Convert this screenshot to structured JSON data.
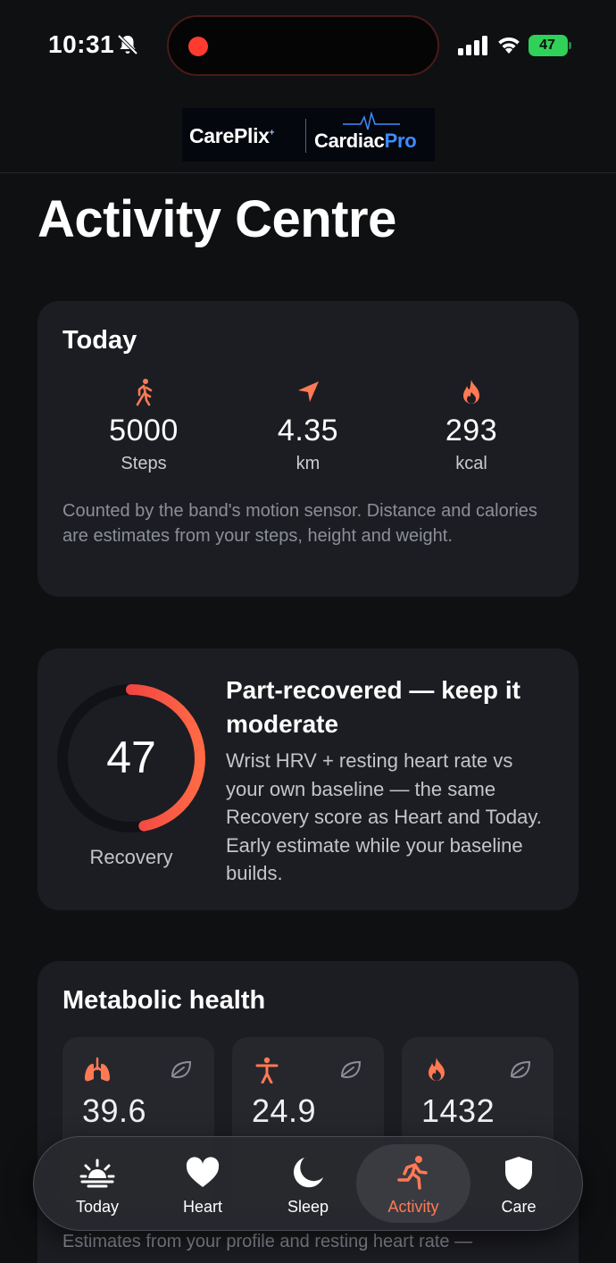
{
  "status_bar": {
    "time": "10:31",
    "battery": "47",
    "icons": [
      "bell-slash-icon",
      "recording-dot-icon",
      "cellular-signal-icon",
      "wifi-icon",
      "battery-icon"
    ]
  },
  "logo": {
    "careplix": "CarePlix",
    "careplix_mark": "+",
    "cardiac": "Cardiac",
    "pro": "Pro"
  },
  "page": {
    "title": "Activity Centre"
  },
  "today": {
    "title": "Today",
    "stats": [
      {
        "icon": "walking-icon",
        "value": "5000",
        "unit": "Steps"
      },
      {
        "icon": "navigation-arrow-icon",
        "value": "4.35",
        "unit": "km"
      },
      {
        "icon": "flame-icon",
        "value": "293",
        "unit": "kcal"
      }
    ],
    "note": "Counted by the band's motion sensor. Distance and calories are estimates from your steps, height and weight."
  },
  "recovery": {
    "score": "47",
    "score_fraction": 0.47,
    "label": "Recovery",
    "title": "Part-recovered — keep it moderate",
    "description": "Wrist HRV + resting heart rate vs your own baseline — the same Recovery score as Heart and Today. Early estimate while your baseline builds."
  },
  "metabolic": {
    "title": "Metabolic health",
    "cards": [
      {
        "icon": "lungs-icon",
        "value": "39.6",
        "label": "",
        "badge_icon": "leaf-icon"
      },
      {
        "icon": "body-figure-icon",
        "value": "24.9",
        "label": "",
        "badge_icon": "leaf-icon"
      },
      {
        "icon": "flame-icon",
        "value": "1432",
        "label": "",
        "badge_icon": "leaf-icon"
      }
    ],
    "note": "Estimates from your profile and resting heart rate —"
  },
  "tabs": [
    {
      "label": "Today",
      "icon": "sunrise-icon",
      "active": false
    },
    {
      "label": "Heart",
      "icon": "heart-icon",
      "active": false
    },
    {
      "label": "Sleep",
      "icon": "moon-icon",
      "active": false
    },
    {
      "label": "Activity",
      "icon": "running-icon",
      "active": true
    },
    {
      "label": "Care",
      "icon": "shield-icon",
      "active": false
    }
  ],
  "colors": {
    "background": "#0f1012",
    "card": "#1c1d22",
    "accent": "#ff7a54",
    "ring_start": "#e5213f",
    "ring_end": "#ff6a45",
    "battery": "#30d158"
  }
}
